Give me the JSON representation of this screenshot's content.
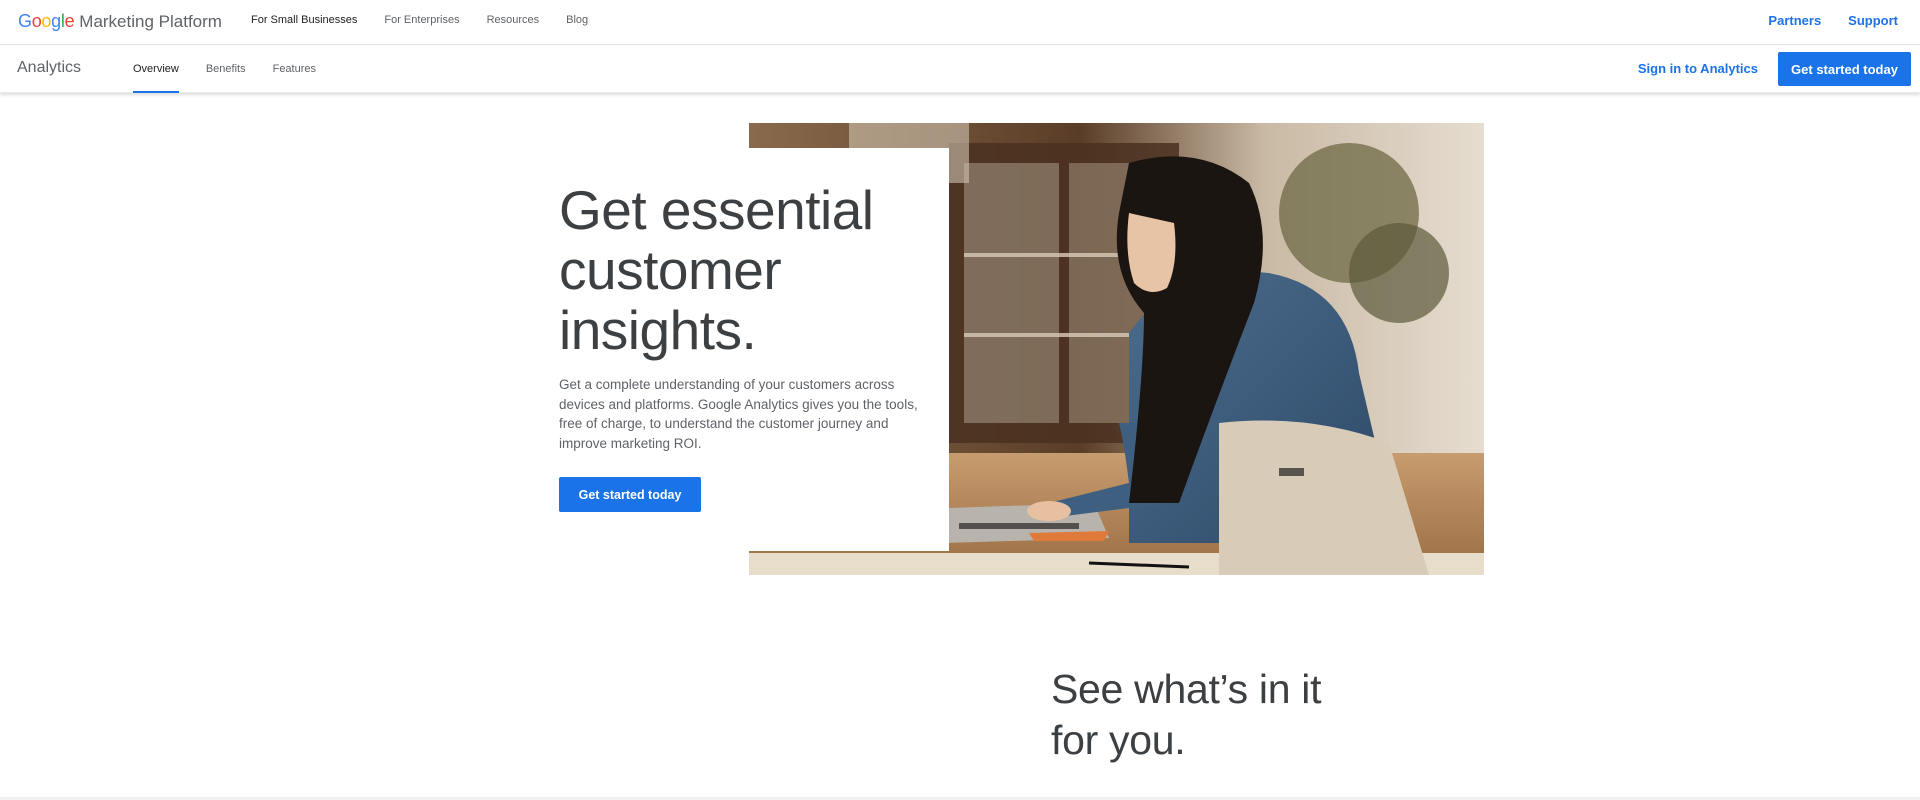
{
  "brand": {
    "google_letters": [
      "G",
      "o",
      "o",
      "g",
      "l",
      "e"
    ],
    "google_colors": [
      "#4285F4",
      "#EA4335",
      "#FBBC05",
      "#4285F4",
      "#34A853",
      "#EA4335"
    ],
    "suffix": "Marketing Platform"
  },
  "topnav": {
    "items": [
      "For Small Businesses",
      "For Enterprises",
      "Resources",
      "Blog"
    ],
    "active_index": 0
  },
  "top_right": {
    "partners": "Partners",
    "support": "Support"
  },
  "subnav": {
    "product": "Analytics",
    "tabs": [
      "Overview",
      "Benefits",
      "Features"
    ],
    "active_index": 0,
    "sign_in": "Sign in to Analytics",
    "cta": "Get started today"
  },
  "hero": {
    "title_lines": [
      "Get essential",
      "customer",
      "insights."
    ],
    "description": "Get a complete understanding of your customers across devices and platforms. Google Analytics gives you the tools, free of charge, to understand the customer journey and improve marketing ROI.",
    "cta": "Get started today",
    "image_alt": "woman-working-on-laptop-photo"
  },
  "section2": {
    "title_lines": [
      "See what’s in it",
      "for you."
    ]
  },
  "colors": {
    "accent": "#1a73e8",
    "text": "#3c4043",
    "muted": "#5f6368"
  }
}
